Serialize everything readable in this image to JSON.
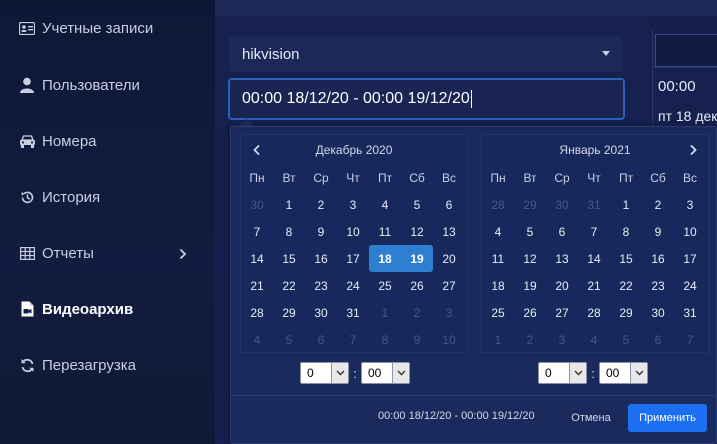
{
  "sidebar": {
    "items": [
      {
        "label": "Учетные записи",
        "icon": "id-card-icon"
      },
      {
        "label": "Пользователи",
        "icon": "user-icon"
      },
      {
        "label": "Номера",
        "icon": "car-icon"
      },
      {
        "label": "История",
        "icon": "history-icon"
      },
      {
        "label": "Отчеты",
        "icon": "table-icon"
      },
      {
        "label": "Видеоархив",
        "icon": "video-file-icon",
        "active": true
      },
      {
        "label": "Перезагрузка",
        "icon": "refresh-icon"
      }
    ]
  },
  "form": {
    "camera_value": "hikvision",
    "range_value": "00:00 18/12/20 - 00:00 19/12/20"
  },
  "right_column": {
    "time": "00:00",
    "date": "пт 18 дек"
  },
  "picker": {
    "weekdays": [
      "Пн",
      "Вт",
      "Ср",
      "Чт",
      "Пт",
      "Сб",
      "Вс"
    ],
    "left": {
      "title": "Декабрь 2020",
      "days": [
        [
          "30",
          "off"
        ],
        [
          "1",
          ""
        ],
        [
          "2",
          ""
        ],
        [
          "3",
          ""
        ],
        [
          "4",
          ""
        ],
        [
          "5",
          ""
        ],
        [
          "6",
          ""
        ],
        [
          "7",
          ""
        ],
        [
          "8",
          ""
        ],
        [
          "9",
          ""
        ],
        [
          "10",
          ""
        ],
        [
          "11",
          ""
        ],
        [
          "12",
          ""
        ],
        [
          "13",
          ""
        ],
        [
          "14",
          ""
        ],
        [
          "15",
          ""
        ],
        [
          "16",
          ""
        ],
        [
          "17",
          ""
        ],
        [
          "18",
          "start"
        ],
        [
          "19",
          "end"
        ],
        [
          "20",
          ""
        ],
        [
          "21",
          ""
        ],
        [
          "22",
          ""
        ],
        [
          "23",
          ""
        ],
        [
          "24",
          ""
        ],
        [
          "25",
          ""
        ],
        [
          "26",
          ""
        ],
        [
          "27",
          ""
        ],
        [
          "28",
          ""
        ],
        [
          "29",
          ""
        ],
        [
          "30",
          ""
        ],
        [
          "31",
          ""
        ],
        [
          "1",
          "off"
        ],
        [
          "2",
          "off"
        ],
        [
          "3",
          "off"
        ],
        [
          "4",
          "off"
        ],
        [
          "5",
          "off"
        ],
        [
          "6",
          "off"
        ],
        [
          "7",
          "off"
        ],
        [
          "8",
          "off"
        ],
        [
          "9",
          "off"
        ],
        [
          "10",
          "off"
        ]
      ],
      "hour": "0",
      "minute": "00"
    },
    "right": {
      "title": "Январь 2021",
      "days": [
        [
          "28",
          "off"
        ],
        [
          "29",
          "off"
        ],
        [
          "30",
          "off"
        ],
        [
          "31",
          "off"
        ],
        [
          "1",
          ""
        ],
        [
          "2",
          ""
        ],
        [
          "3",
          ""
        ],
        [
          "4",
          ""
        ],
        [
          "5",
          ""
        ],
        [
          "6",
          ""
        ],
        [
          "7",
          ""
        ],
        [
          "8",
          ""
        ],
        [
          "9",
          ""
        ],
        [
          "10",
          ""
        ],
        [
          "11",
          ""
        ],
        [
          "12",
          ""
        ],
        [
          "13",
          ""
        ],
        [
          "14",
          ""
        ],
        [
          "15",
          ""
        ],
        [
          "16",
          ""
        ],
        [
          "17",
          ""
        ],
        [
          "18",
          ""
        ],
        [
          "19",
          ""
        ],
        [
          "20",
          ""
        ],
        [
          "21",
          ""
        ],
        [
          "22",
          ""
        ],
        [
          "23",
          ""
        ],
        [
          "24",
          ""
        ],
        [
          "25",
          ""
        ],
        [
          "26",
          ""
        ],
        [
          "27",
          ""
        ],
        [
          "28",
          ""
        ],
        [
          "29",
          ""
        ],
        [
          "30",
          ""
        ],
        [
          "31",
          ""
        ],
        [
          "1",
          "off"
        ],
        [
          "2",
          "off"
        ],
        [
          "3",
          "off"
        ],
        [
          "4",
          "off"
        ],
        [
          "5",
          "off"
        ],
        [
          "6",
          "off"
        ],
        [
          "7",
          "off"
        ]
      ],
      "hour": "0",
      "minute": "00"
    },
    "time_separator": ":",
    "summary": "00:00 18/12/20 - 00:00 19/12/20",
    "cancel_label": "Отмена",
    "apply_label": "Применить"
  },
  "colors": {
    "accent": "#1b6ff0",
    "selected_day": "#2f7fd0",
    "background": "#16204a"
  }
}
